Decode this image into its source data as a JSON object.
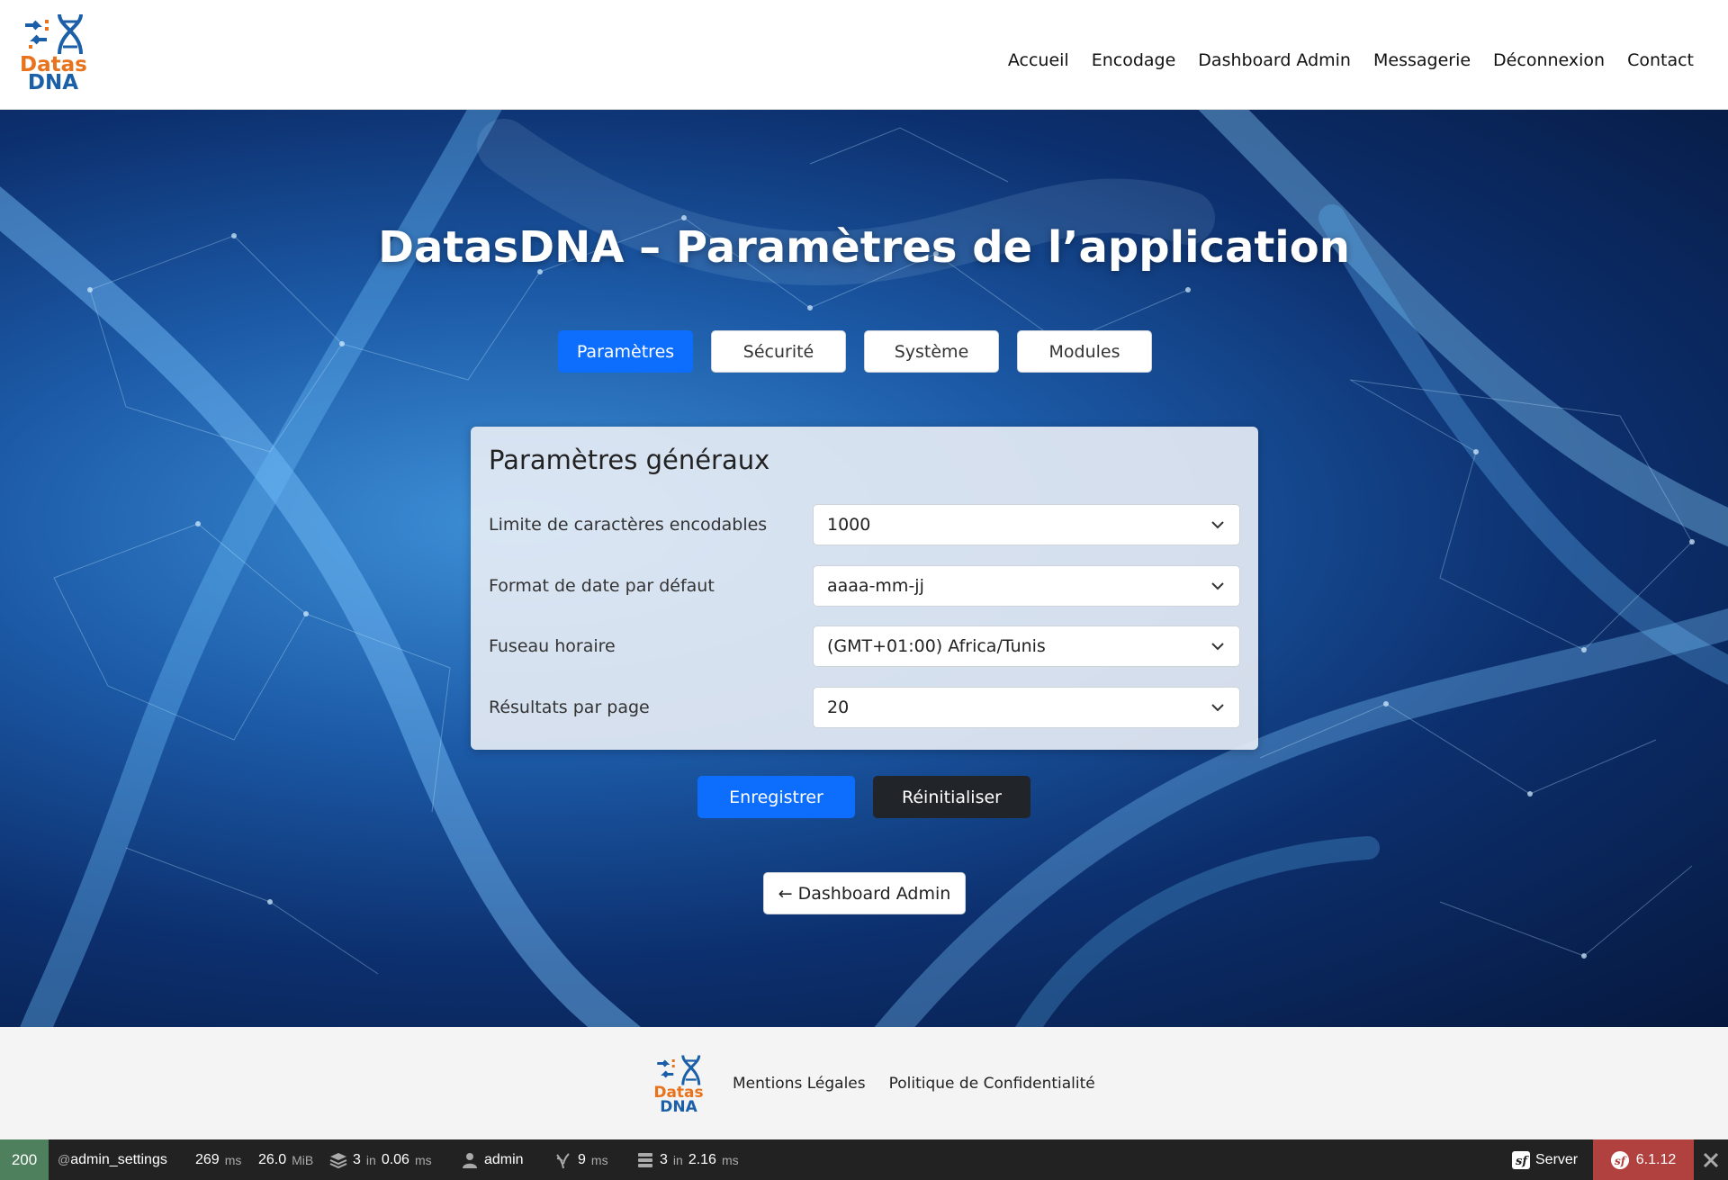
{
  "header": {
    "logo": {
      "word1": "Datas",
      "word2": "DNA"
    },
    "nav": [
      "Accueil",
      "Encodage",
      "Dashboard Admin",
      "Messagerie",
      "Déconnexion",
      "Contact"
    ]
  },
  "hero": {
    "title": "DatasDNA – Paramètres de l’application",
    "tabs": [
      "Paramètres",
      "Sécurité",
      "Système",
      "Modules"
    ],
    "active_tab": "Paramètres"
  },
  "settings": {
    "title": "Paramètres généraux",
    "fields": [
      {
        "label": "Limite de caractères encodables",
        "value": "1000"
      },
      {
        "label": "Format de date par défaut",
        "value": "aaaa-mm-jj"
      },
      {
        "label": "Fuseau horaire",
        "value": "(GMT+01:00) Africa/Tunis"
      },
      {
        "label": "Résultats par page",
        "value": "20"
      }
    ]
  },
  "actions": {
    "save": "Enregistrer",
    "reset": "Réinitialiser",
    "back": "← Dashboard Admin"
  },
  "footer": {
    "logo": {
      "word1": "Datas",
      "word2": "DNA"
    },
    "links": [
      "Mentions Légales",
      "Politique de Confidentialité"
    ]
  },
  "toolbar": {
    "status": "200",
    "route_prefix": "@",
    "route": "admin_settings",
    "time": "269",
    "time_unit": "ms",
    "memory": "26.0",
    "memory_unit": "MiB",
    "cache_count": "3",
    "cache_in": "in",
    "cache_time": "0.06",
    "cache_unit": "ms",
    "user": "admin",
    "twig_time": "9",
    "twig_unit": "ms",
    "db_count": "3",
    "db_in": "in",
    "db_time": "2.16",
    "db_unit": "ms",
    "server": "Server",
    "version": "6.1.12"
  },
  "colors": {
    "primary": "#0d6efd",
    "dark": "#212529",
    "status_ok": "#4f805d",
    "version_bg": "#b0413e",
    "logo_orange": "#e8731c",
    "logo_blue": "#1b5fa8"
  }
}
